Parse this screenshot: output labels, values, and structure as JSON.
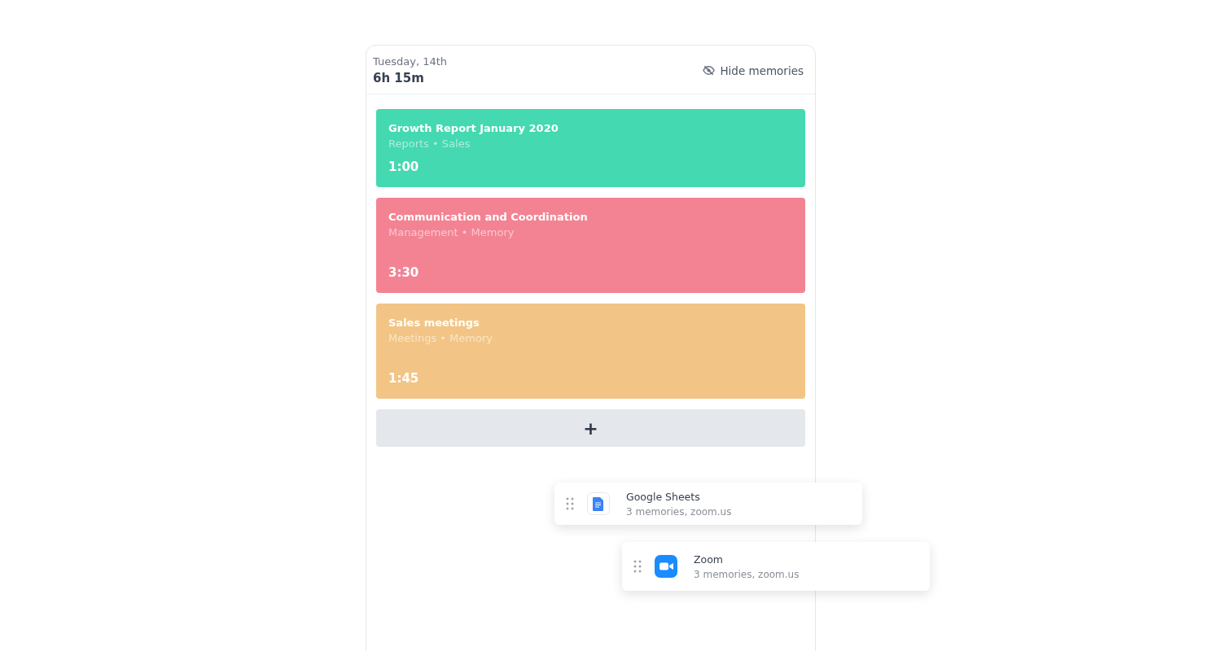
{
  "header": {
    "date": "Tuesday, 14th",
    "total": "6h 15m",
    "toggle": "Hide memories"
  },
  "entries": [
    {
      "title": "Growth Report January 2020",
      "tags": "Reports • Sales",
      "duration": "1:00",
      "color": "#44d9b0",
      "tall": false
    },
    {
      "title": "Communication and Coordination",
      "tags": "Management •  Memory",
      "duration": "3:30",
      "color": "#f38393",
      "tall": true
    },
    {
      "title": "Sales meetings",
      "tags": "Meetings • Memory",
      "duration": "1:45",
      "color": "#f2c586",
      "tall": true
    }
  ],
  "add_button": "+",
  "memories": [
    {
      "kind": "doc",
      "name": "Google Sheets",
      "detail": "3 memories, zoom.us"
    },
    {
      "kind": "video",
      "name": "Zoom",
      "detail": "3 memories, zoom.us"
    }
  ]
}
